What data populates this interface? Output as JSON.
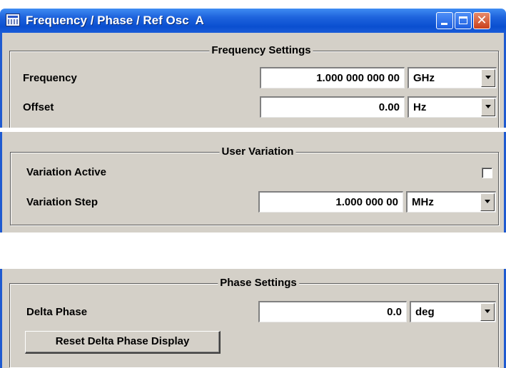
{
  "window": {
    "title": "Frequency / Phase / Ref Osc  A"
  },
  "frequency_settings": {
    "legend": "Frequency Settings",
    "frequency": {
      "label": "Frequency",
      "value": "1.000 000 000 00",
      "unit": "GHz"
    },
    "offset": {
      "label": "Offset",
      "value": "0.00",
      "unit": "Hz"
    }
  },
  "user_variation": {
    "legend": "User Variation",
    "variation_active": {
      "label": "Variation Active",
      "checked": false
    },
    "variation_step": {
      "label": "Variation Step",
      "value": "1.000 000 00",
      "unit": "MHz"
    }
  },
  "phase_settings": {
    "legend": "Phase Settings",
    "delta_phase": {
      "label": "Delta Phase",
      "value": "0.0",
      "unit": "deg"
    },
    "reset_button": "Reset Delta Phase Display"
  },
  "icons": {
    "app": "window-app-icon",
    "minimize": "minimize-icon",
    "maximize": "maximize-icon",
    "close": "close-icon",
    "dropdown": "chevron-down-icon"
  },
  "colors": {
    "titlebar": "#0a4fd0",
    "panel_bg": "#d4d0c8",
    "window_border": "#1f5ad0",
    "close_button": "#c9401c"
  }
}
